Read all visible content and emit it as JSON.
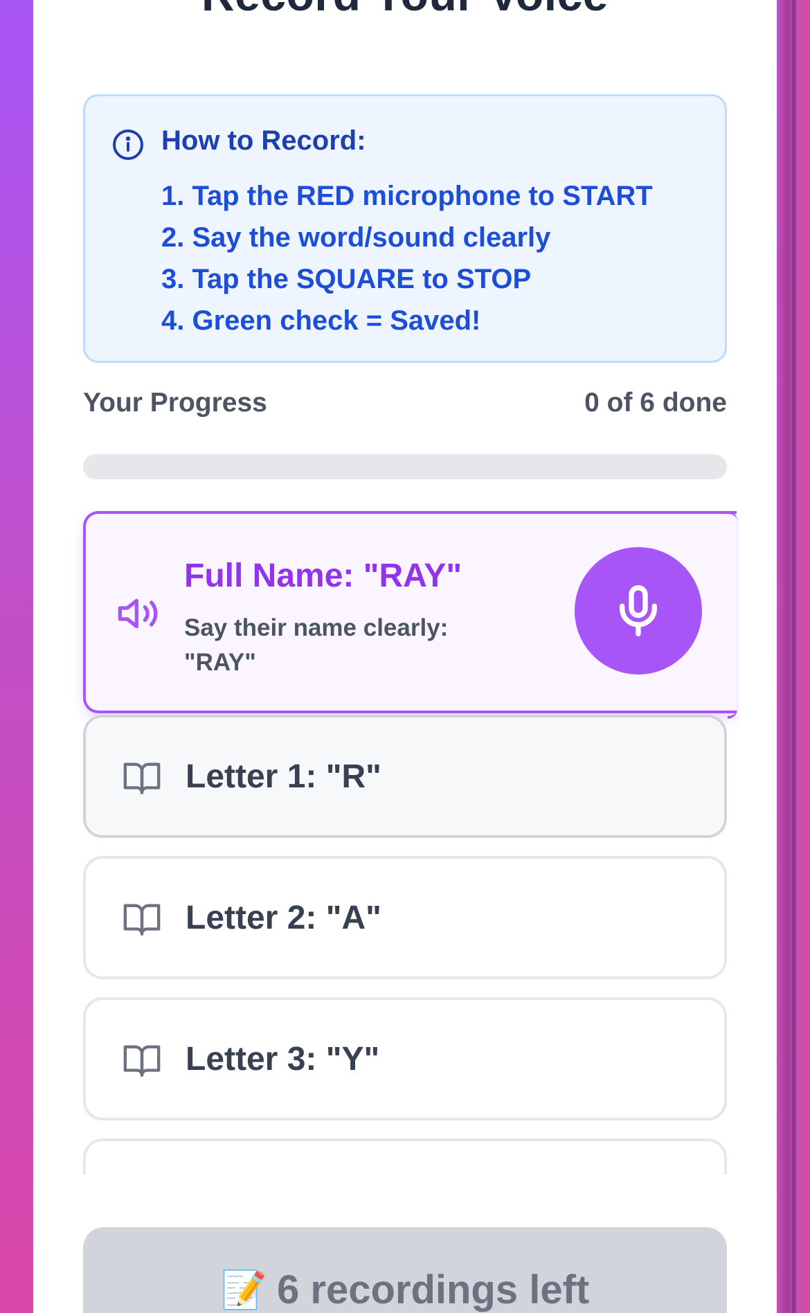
{
  "header": {
    "title": "Record Your Voice",
    "back_icon": "arrow-left-icon"
  },
  "instructions": {
    "title": "How to Record:",
    "icon": "info-icon",
    "steps": [
      "1. Tap the RED microphone to START",
      "2. Say the word/sound clearly",
      "3. Tap the SQUARE to STOP",
      "4. Green check = Saved!"
    ]
  },
  "progress": {
    "label": "Your Progress",
    "count_text": "0 of 6 done",
    "completed": 0,
    "total": 6
  },
  "recordings": {
    "active": {
      "title": "Full Name: \"RAY\"",
      "subtitle": "Say their name clearly: \"RAY\"",
      "icon": "speaker-icon",
      "button_icon": "microphone-icon"
    },
    "items": [
      {
        "label": "Letter 1: \"R\"",
        "icon": "book-open-icon"
      },
      {
        "label": "Letter 2: \"A\"",
        "icon": "book-open-icon"
      },
      {
        "label": "Letter 3: \"Y\"",
        "icon": "book-open-icon"
      }
    ]
  },
  "footer": {
    "emoji": "📝",
    "label": "6 recordings left"
  },
  "colors": {
    "accent": "#a855f7",
    "info_text": "#1d4ed8",
    "info_bg": "#eef5fe",
    "title": "#1e293b"
  }
}
